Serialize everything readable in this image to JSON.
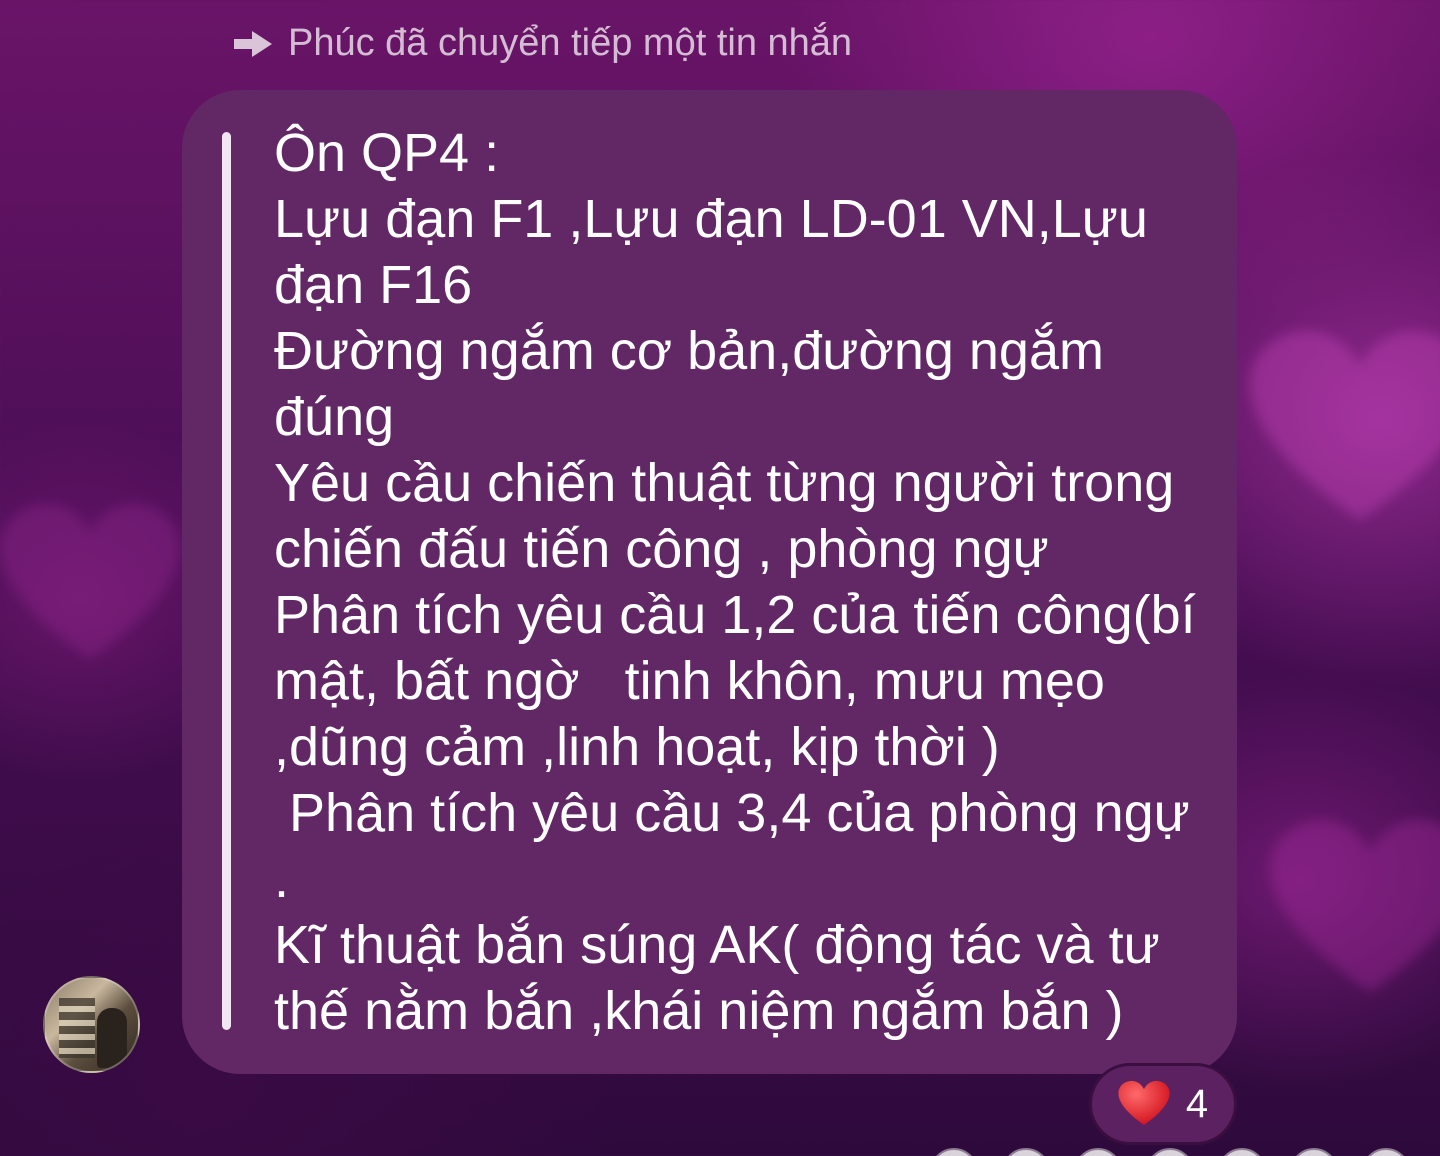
{
  "forward": {
    "text": "Phúc đã chuyển tiếp một tin nhắn",
    "icon": "forward-arrow-icon"
  },
  "message": {
    "text": "Ôn QP4 :\nLựu đạn F1 ,Lựu đạn LD-01 VN,Lựu đạn F16\nĐường ngắm cơ bản,đường ngắm đúng\nYêu cầu chiến thuật từng người trong chiến đấu tiến công , phòng ngự\nPhân tích yêu cầu 1,2 của tiến công(bí mật, bất ngờ   tinh khôn, mưu mẹo ,dũng cảm ,linh hoạt, kịp thời )\n Phân tích yêu cầu 3,4 của phòng ngự .\nKĩ thuật bắn súng AK( động tác và tư thế nằm bắn ,khái niệm ngắm bắn )",
    "bubble_color": "#622866",
    "quote_bar_color": "#f2e6f2"
  },
  "reaction": {
    "icon": "heart-icon",
    "count": "4",
    "heart_color": "#e8202a"
  },
  "background": {
    "primary": "#6a1468",
    "secondary": "#2e0a3c"
  }
}
